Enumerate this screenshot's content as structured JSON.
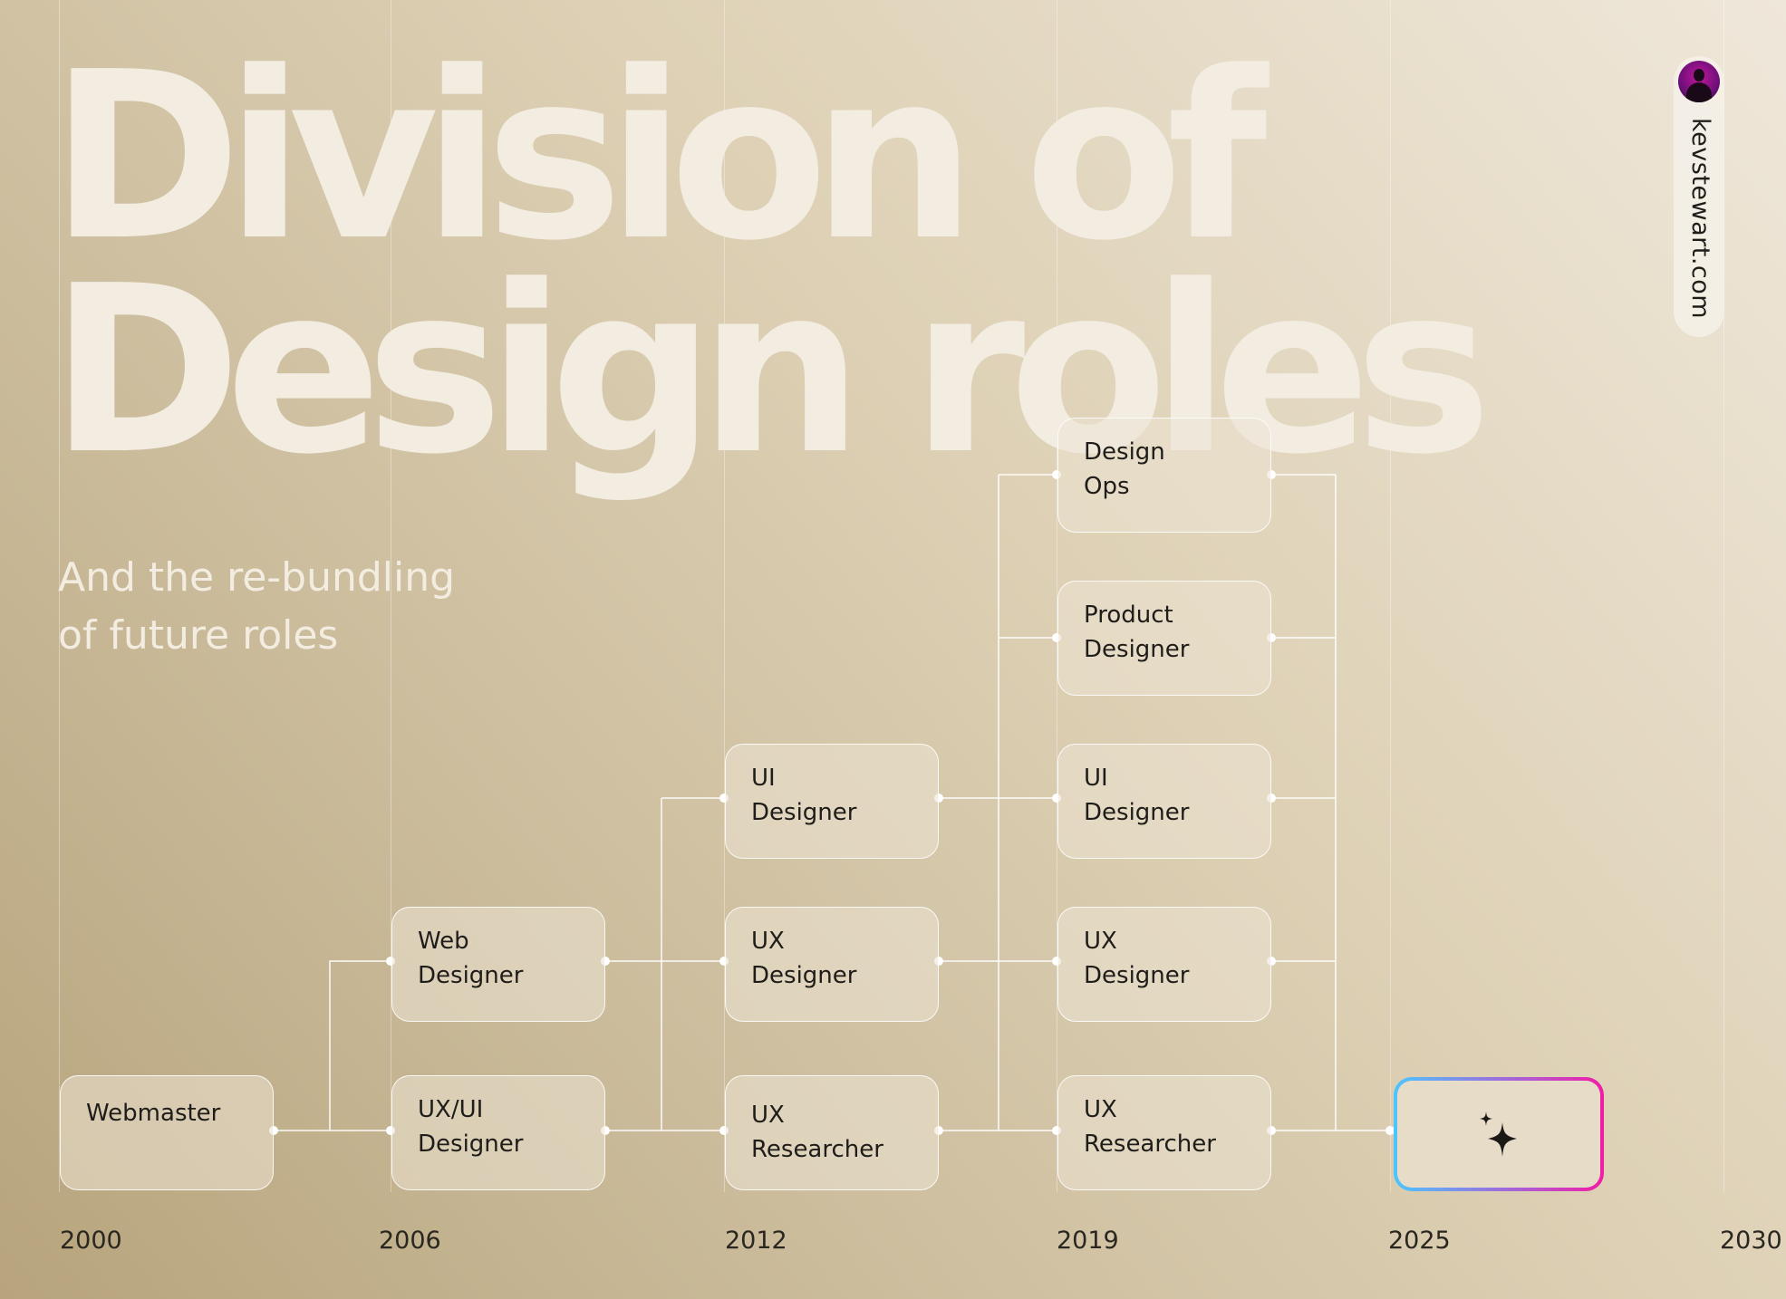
{
  "title": {
    "line1": "Division of",
    "line2": "Design roles"
  },
  "subtitle": {
    "line1": "And the re-bundling",
    "line2": "of future roles"
  },
  "roles": [
    {
      "id": "webmaster",
      "lines": [
        "Webmaster"
      ]
    },
    {
      "id": "web-designer",
      "lines": [
        "Web",
        "Designer"
      ]
    },
    {
      "id": "ux-ui-designer",
      "lines": [
        "UX/UI",
        "Designer"
      ]
    },
    {
      "id": "ui-designer-2012",
      "lines": [
        "UI",
        "Designer"
      ]
    },
    {
      "id": "ux-designer-2012",
      "lines": [
        "UX",
        "Designer"
      ]
    },
    {
      "id": "ux-researcher-2012",
      "lines": [
        "UX",
        "Researcher"
      ]
    },
    {
      "id": "design-ops",
      "lines": [
        "Design",
        "Ops"
      ]
    },
    {
      "id": "product-designer",
      "lines": [
        "Product",
        "Designer"
      ]
    },
    {
      "id": "ui-designer-2019",
      "lines": [
        "UI",
        "Designer"
      ]
    },
    {
      "id": "ux-designer-2019",
      "lines": [
        "UX",
        "Designer"
      ]
    },
    {
      "id": "ux-researcher-2019",
      "lines": [
        "UX",
        "Researcher"
      ]
    }
  ],
  "future_role": {
    "icon": "sparkle-icon",
    "border_gradient": [
      "#4cc6ff",
      "#9a6fe0",
      "#f21ca6"
    ]
  },
  "years": [
    "2000",
    "2006",
    "2012",
    "2019",
    "2025",
    "2030"
  ],
  "site": {
    "url": "kevstewart.com",
    "avatar_icon": "avatar"
  },
  "colors": {
    "title": "#f2ece1",
    "connector": "#ffffff",
    "text": "#1f1d1a"
  }
}
